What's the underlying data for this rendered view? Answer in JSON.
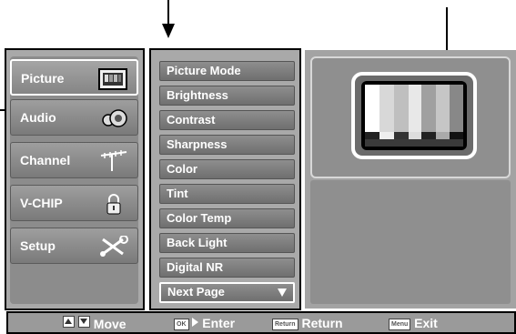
{
  "categories": [
    {
      "label": "Picture",
      "icon": "tv-icon",
      "active": true
    },
    {
      "label": "Audio",
      "icon": "speaker-icon",
      "active": false
    },
    {
      "label": "Channel",
      "icon": "antenna-icon",
      "active": false
    },
    {
      "label": "V-CHIP",
      "icon": "lock-icon",
      "active": false
    },
    {
      "label": "Setup",
      "icon": "tools-icon",
      "active": false
    }
  ],
  "menu_items": [
    "Picture Mode",
    "Brightness",
    "Contrast",
    "Sharpness",
    "Color",
    "Tint",
    "Color Temp",
    "Back Light",
    "Digital NR"
  ],
  "next_page": "Next Page",
  "footer": {
    "move": "Move",
    "ok_key": "OK",
    "enter": "Enter",
    "return_key": "Return",
    "return": "Return",
    "menu_key": "Menu",
    "exit": "Exit"
  },
  "colors": {
    "panel_gray": "#a9a9a9",
    "button_gray": "#7a7a7a",
    "highlight": "#ffffff"
  }
}
